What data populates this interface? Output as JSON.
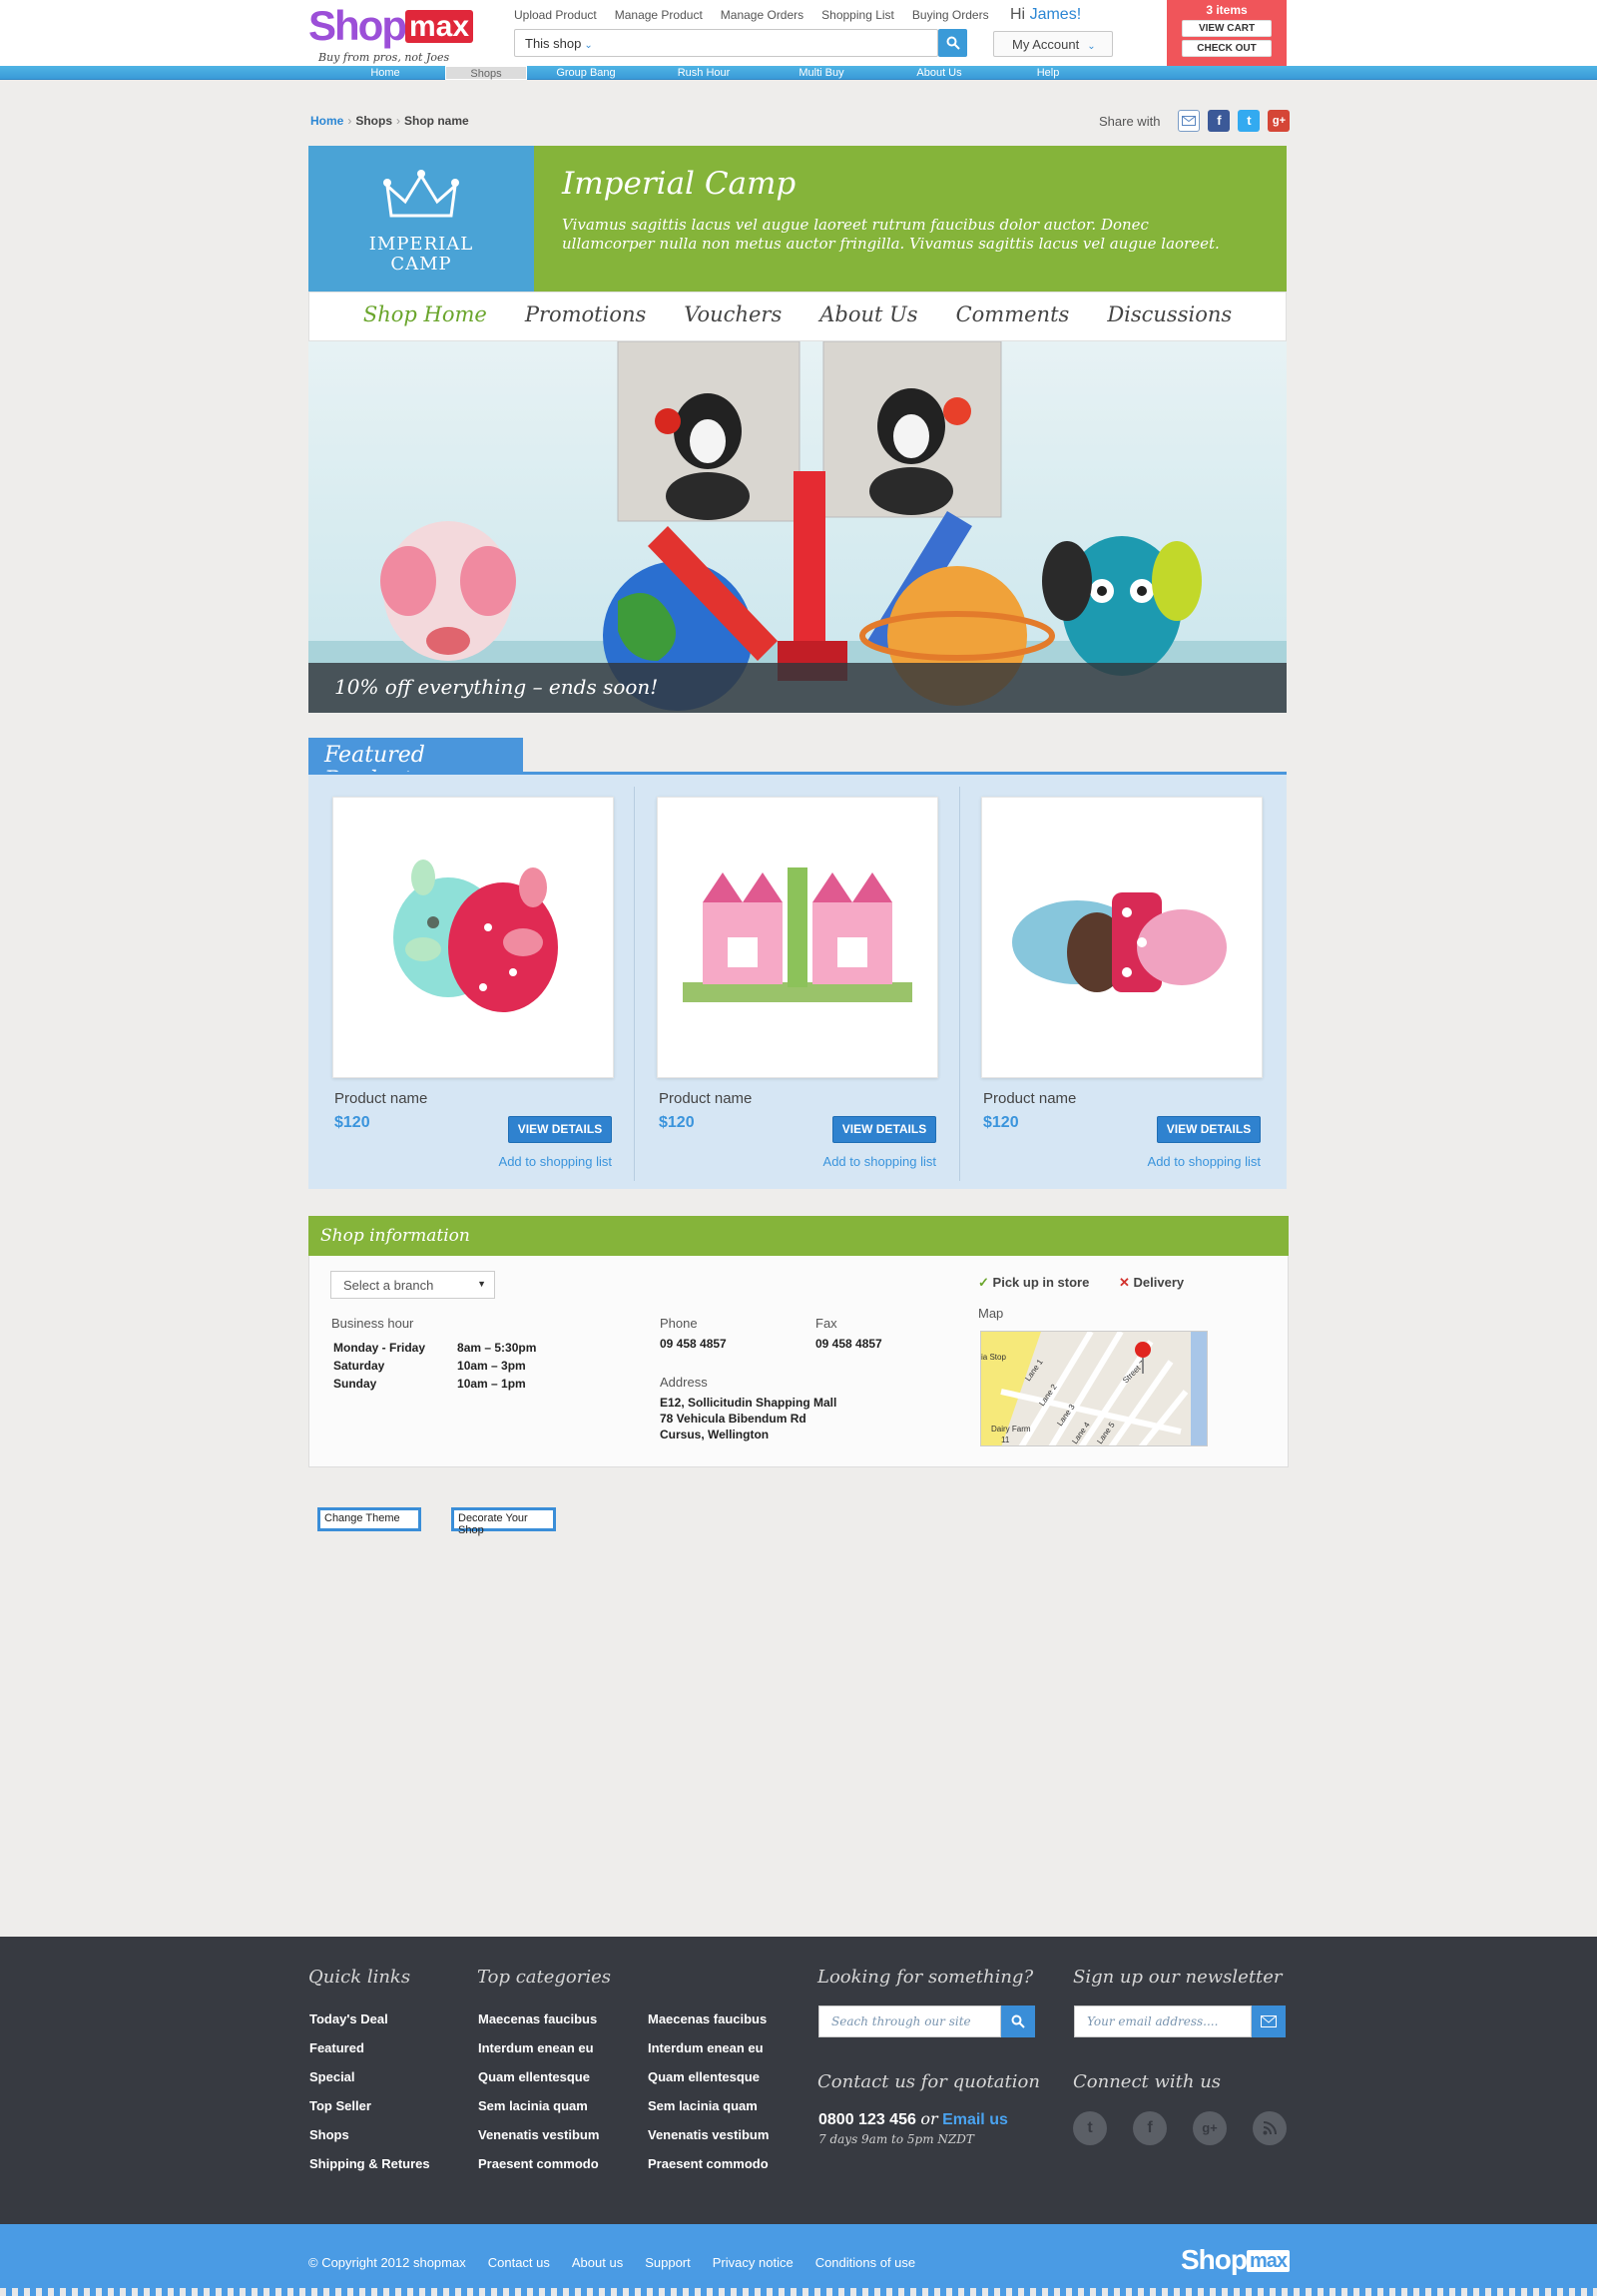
{
  "brand": {
    "logo_text_a": "Shop",
    "logo_text_b": "max",
    "tagline": "Buy from pros, not Joes"
  },
  "header": {
    "top_links": [
      "Upload Product",
      "Manage Product",
      "Manage Orders",
      "Shopping List",
      "Buying Orders"
    ],
    "search_scope": "This shop",
    "greeting": "Hi",
    "user_name": "James!",
    "account_label": "My Account",
    "cart": {
      "items": "3 items",
      "view_cart": "VIEW CART",
      "check_out": "CHECK OUT"
    }
  },
  "nav": {
    "items": [
      "Home",
      "Shops",
      "Group Bang",
      "Rush Hour",
      "Multi Buy",
      "About Us",
      "Help"
    ],
    "active": "Shops"
  },
  "breadcrumb": {
    "home": "Home",
    "shops": "Shops",
    "current": "Shop name"
  },
  "share": {
    "label": "Share with",
    "icons": [
      "email-icon",
      "facebook-icon",
      "twitter-icon",
      "google-plus-icon"
    ]
  },
  "shop": {
    "logo_line1": "IMPERIAL",
    "logo_line2": "CAMP",
    "title": "Imperial Camp",
    "description": "Vivamus sagittis lacus vel augue laoreet rutrum faucibus dolor auctor. Donec ullamcorper nulla non metus auctor fringilla. Vivamus sagittis lacus vel augue laoreet.",
    "tabs": [
      "Shop Home",
      "Promotions",
      "Vouchers",
      "About Us",
      "Comments",
      "Discussions"
    ],
    "active_tab": "Shop Home"
  },
  "hero": {
    "caption": "10% off everything – ends soon!"
  },
  "featured": {
    "title": "Featured Products",
    "products": [
      {
        "name": "Product name",
        "price": "$120",
        "button": "VIEW DETAILS",
        "add": "Add to shopping list"
      },
      {
        "name": "Product name",
        "price": "$120",
        "button": "VIEW DETAILS",
        "add": "Add to shopping list"
      },
      {
        "name": "Product name",
        "price": "$120",
        "button": "VIEW DETAILS",
        "add": "Add to shopping list"
      }
    ]
  },
  "info": {
    "title": "Shop information",
    "branch_placeholder": "Select a branch",
    "business_hour_label": "Business hour",
    "hours": [
      {
        "day": "Monday - Friday",
        "time": "8am – 5:30pm"
      },
      {
        "day": "Saturday",
        "time": "10am – 3pm"
      },
      {
        "day": "Sunday",
        "time": "10am – 1pm"
      }
    ],
    "phone_label": "Phone",
    "phone": "09 458 4857",
    "fax_label": "Fax",
    "fax": "09 458 4857",
    "address_label": "Address",
    "address_lines": [
      "E12, Sollicitudin Shapping Mall",
      "78 Vehicula Bibendum Rd",
      "Cursus, Wellington"
    ],
    "pickup": "Pick up in store",
    "delivery": "Delivery",
    "map_label": "Map",
    "map_texts": [
      "ia Stop",
      "Lane 1",
      "Lane 2",
      "Lane 3",
      "Lane 4",
      "Lane 5",
      "Street 7",
      "Dairy Farm",
      "11"
    ]
  },
  "actions": {
    "change_theme": "Change Theme",
    "decorate": "Decorate Your Shop"
  },
  "footer": {
    "quick_links_title": "Quick links",
    "quick_links": [
      "Today's Deal",
      "Featured",
      "Special",
      "Top Seller",
      "Shops",
      "Shipping & Retures"
    ],
    "top_categories_title": "Top categories",
    "categories_col1": [
      "Maecenas faucibus",
      "Interdum enean eu",
      "Quam ellentesque",
      "Sem lacinia quam",
      "Venenatis vestibum",
      "Praesent commodo"
    ],
    "categories_col2": [
      "Maecenas faucibus",
      "Interdum enean eu",
      "Quam ellentesque",
      "Sem lacinia quam",
      "Venenatis vestibum",
      "Praesent commodo"
    ],
    "search_title": "Looking for something?",
    "search_placeholder": "Seach through our site",
    "newsletter_title": "Sign up our newsletter",
    "newsletter_placeholder": "Your email address....",
    "contact_title": "Contact us for quotation",
    "phone": "0800 123 456",
    "or": "or",
    "email_link": "Email us",
    "hours": "7 days 9am to 5pm NZDT",
    "connect_title": "Connect with us",
    "social_icons": [
      "twitter-icon",
      "facebook-icon",
      "google-plus-icon",
      "rss-icon"
    ]
  },
  "bottom": {
    "copyright": "© Copyright 2012 shopmax",
    "links": [
      "Contact us",
      "About us",
      "Support",
      "Privacy notice",
      "Conditions of use"
    ],
    "logo_a": "Shop",
    "logo_b": "max"
  },
  "colors": {
    "blue": "#4a96dc",
    "green": "#85b43a",
    "red": "#f0555a",
    "footer": "#373a41"
  }
}
